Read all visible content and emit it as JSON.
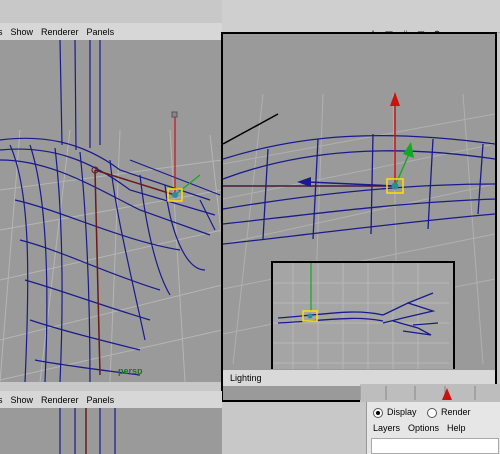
{
  "top_menu": [
    "Show",
    "Renderer",
    "Panels"
  ],
  "top_partial_label": "s",
  "bottom_menu": [
    "Show",
    "Renderer",
    "Panels"
  ],
  "bottom_partial_label": "s",
  "persp_label": "persp",
  "lighting_label": "Lighting",
  "icons": [
    "axis-icon",
    "camera-icon",
    "grid-icon",
    "frame-icon",
    "settings-icon"
  ],
  "layer_panel": {
    "radio_display": "Display",
    "radio_render": "Render",
    "menu": [
      "Layers",
      "Options",
      "Help"
    ]
  },
  "colors": {
    "viewport_bg": "#9a9a9a",
    "wire": "#1a1a8c",
    "y_axis": "#cc1111",
    "x_axis": "#1a1a8c",
    "z_axis": "#11aa22",
    "selected": "#ffe000"
  }
}
